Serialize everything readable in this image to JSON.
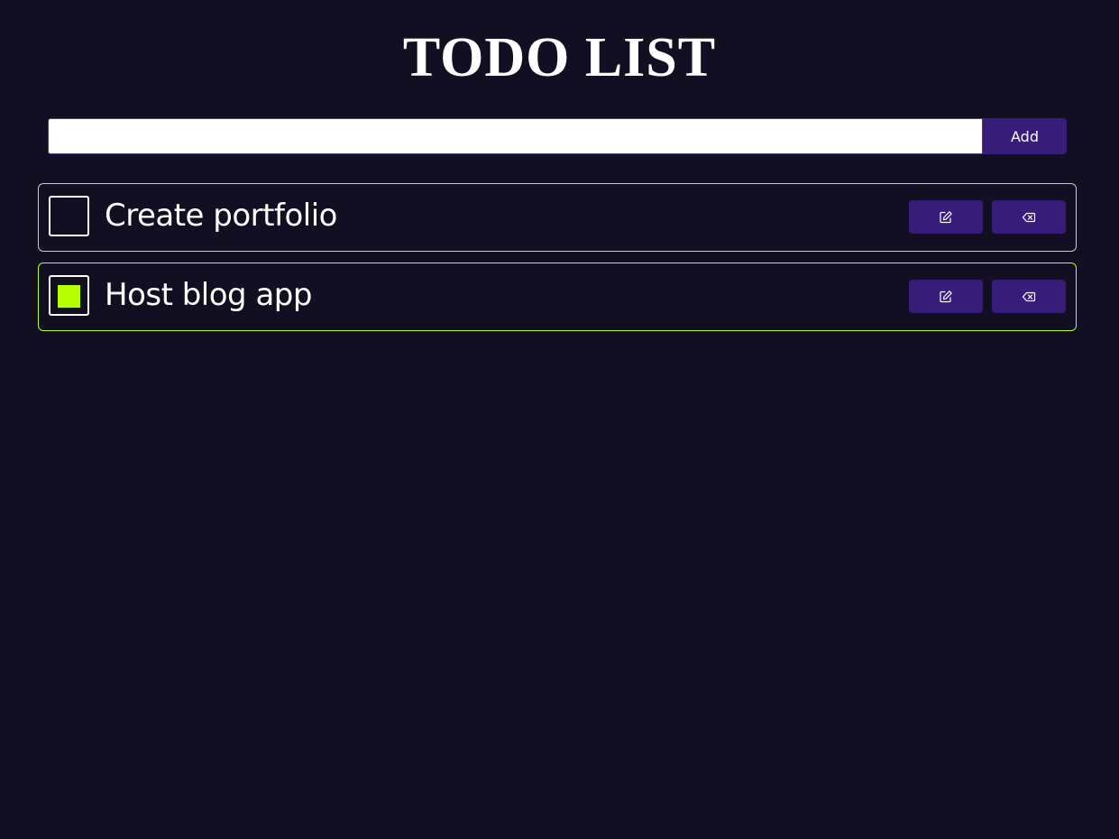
{
  "app": {
    "title": "TODO LIST"
  },
  "form": {
    "input_value": "",
    "input_placeholder": "",
    "add_label": "Add"
  },
  "todos": [
    {
      "text": "Create portfolio",
      "completed": false
    },
    {
      "text": "Host blog app",
      "completed": true
    }
  ],
  "icons": {
    "edit": "pencil-square-icon",
    "delete": "backspace-x-icon"
  },
  "colors": {
    "background": "#130f22",
    "button": "#371c7a",
    "accent": "#b8ff00",
    "border": "#c9c6d6"
  }
}
